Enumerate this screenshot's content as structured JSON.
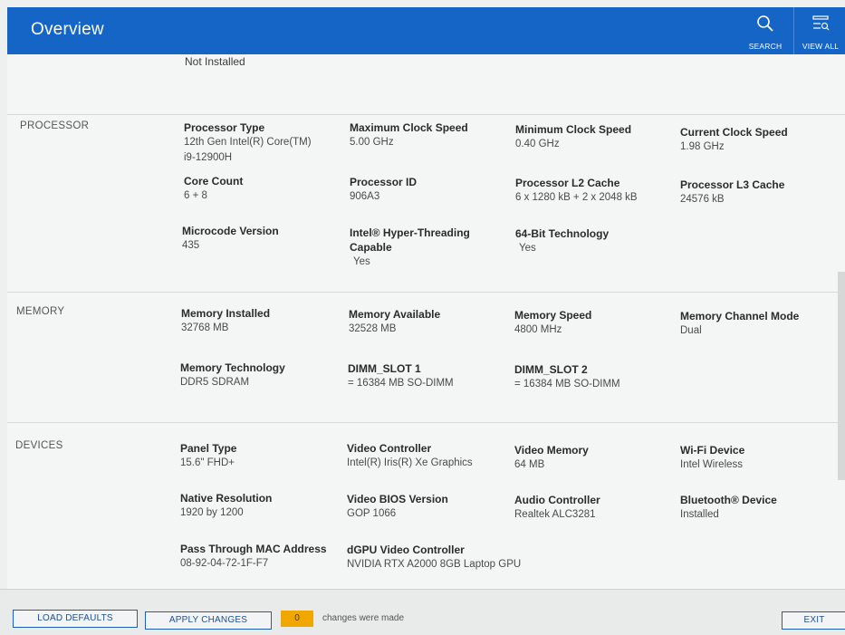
{
  "header": {
    "title": "Overview",
    "search_label": "SEARCH",
    "view_all_label": "VIEW ALL"
  },
  "top_value": "Not Installed",
  "sections": {
    "processor": {
      "label": "PROCESSOR",
      "fields": [
        {
          "label": "Processor Type",
          "value": "12th Gen Intel(R) Core(TM)\ni9-12900H"
        },
        {
          "label": "Maximum Clock Speed",
          "value": "5.00 GHz"
        },
        {
          "label": "Minimum Clock Speed",
          "value": "0.40 GHz"
        },
        {
          "label": "Current Clock Speed",
          "value": "1.98 GHz"
        },
        {
          "label": "Core Count",
          "value": "6 + 8"
        },
        {
          "label": "Processor ID",
          "value": "906A3"
        },
        {
          "label": "Processor L2 Cache",
          "value": "6 x 1280  kB + 2 x 2048  kB"
        },
        {
          "label": "Processor L3 Cache",
          "value": "24576 kB"
        },
        {
          "label": "Microcode Version",
          "value": "435"
        },
        {
          "label": "Intel® Hyper-Threading Capable",
          "value": "Yes"
        },
        {
          "label": "64-Bit Technology",
          "value": "Yes"
        }
      ]
    },
    "memory": {
      "label": "MEMORY",
      "fields": [
        {
          "label": "Memory Installed",
          "value": "32768 MB"
        },
        {
          "label": "Memory Available",
          "value": "32528 MB"
        },
        {
          "label": "Memory Speed",
          "value": "4800 MHz"
        },
        {
          "label": "Memory Channel Mode",
          "value": "Dual"
        },
        {
          "label": "Memory Technology",
          "value": "DDR5 SDRAM"
        },
        {
          "label": "DIMM_SLOT 1",
          "value": "= 16384 MB SO-DIMM"
        },
        {
          "label": "DIMM_SLOT 2",
          "value": "= 16384 MB SO-DIMM"
        }
      ]
    },
    "devices": {
      "label": "DEVICES",
      "fields": [
        {
          "label": "Panel Type",
          "value": "15.6\" FHD+"
        },
        {
          "label": "Video Controller",
          "value": "Intel(R) Iris(R) Xe Graphics"
        },
        {
          "label": "Video Memory",
          "value": "64 MB"
        },
        {
          "label": "Wi-Fi Device",
          "value": "Intel Wireless"
        },
        {
          "label": "Native Resolution",
          "value": "1920 by 1200"
        },
        {
          "label": "Video BIOS Version",
          "value": "GOP 1066"
        },
        {
          "label": "Audio Controller",
          "value": "Realtek ALC3281"
        },
        {
          "label": "Bluetooth® Device",
          "value": "Installed"
        },
        {
          "label": "Pass Through MAC Address",
          "value": "08-92-04-72-1F-F7"
        },
        {
          "label": "dGPU Video Controller",
          "value": "NVIDIA RTX A2000 8GB Laptop GPU"
        }
      ]
    }
  },
  "footer": {
    "load_defaults": "LOAD DEFAULTS",
    "apply_changes": "APPLY CHANGES",
    "changes_count": "0",
    "changes_text": "changes were made",
    "exit": "EXIT"
  },
  "colors": {
    "header_bg": "#1565c6",
    "badge": "#f0a800",
    "button_border": "#1e5fb4"
  },
  "icons": {
    "search": "search-icon",
    "view_all": "list-settings-icon"
  }
}
